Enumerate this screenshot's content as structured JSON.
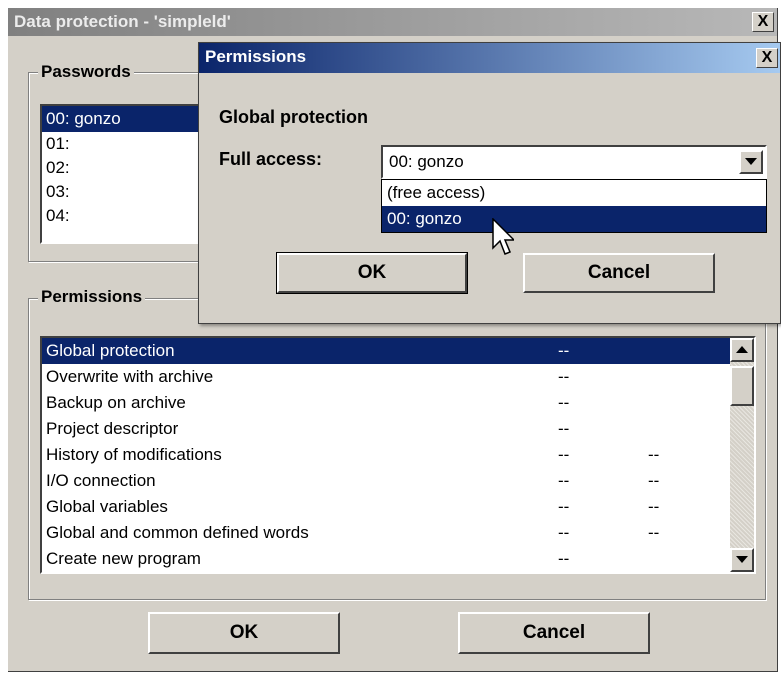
{
  "main_dialog": {
    "title": "Data protection - 'simpleld'",
    "close_glyph": "X",
    "passwords_group": {
      "label": "Passwords",
      "items": [
        "00: gonzo",
        "01:",
        "02:",
        "03:",
        "04:"
      ],
      "selected_index": 0
    },
    "permissions_group": {
      "label": "Permissions",
      "rows": [
        {
          "name": "Global protection",
          "full": "--",
          "read": ""
        },
        {
          "name": "Overwrite with archive",
          "full": "--",
          "read": ""
        },
        {
          "name": "Backup on archive",
          "full": "--",
          "read": ""
        },
        {
          "name": "Project descriptor",
          "full": "--",
          "read": ""
        },
        {
          "name": "History of modifications",
          "full": "--",
          "read": "--"
        },
        {
          "name": "I/O connection",
          "full": "--",
          "read": "--"
        },
        {
          "name": "Global variables",
          "full": "--",
          "read": "--"
        },
        {
          "name": "Global and common defined words",
          "full": "--",
          "read": "--"
        },
        {
          "name": "Create new program",
          "full": "--",
          "read": ""
        }
      ],
      "selected_index": 0
    },
    "ok_label": "OK",
    "cancel_label": "Cancel"
  },
  "permissions_dialog": {
    "title": "Permissions",
    "close_glyph": "X",
    "section_label": "Global protection",
    "full_access_label": "Full access:",
    "combo_value": "00: gonzo",
    "dropdown_options": [
      "(free access)",
      "00: gonzo"
    ],
    "dropdown_selected_index": 1,
    "ok_label": "OK",
    "cancel_label": "Cancel"
  },
  "icons": [
    "close-icon",
    "combo-arrow-icon",
    "scroll-up-icon",
    "scroll-down-icon",
    "mouse-pointer-icon"
  ],
  "colors": {
    "selection": "#0a246a",
    "face": "#d4d0c8",
    "active_title": "#0a246a",
    "inactive_title": "#808080"
  }
}
